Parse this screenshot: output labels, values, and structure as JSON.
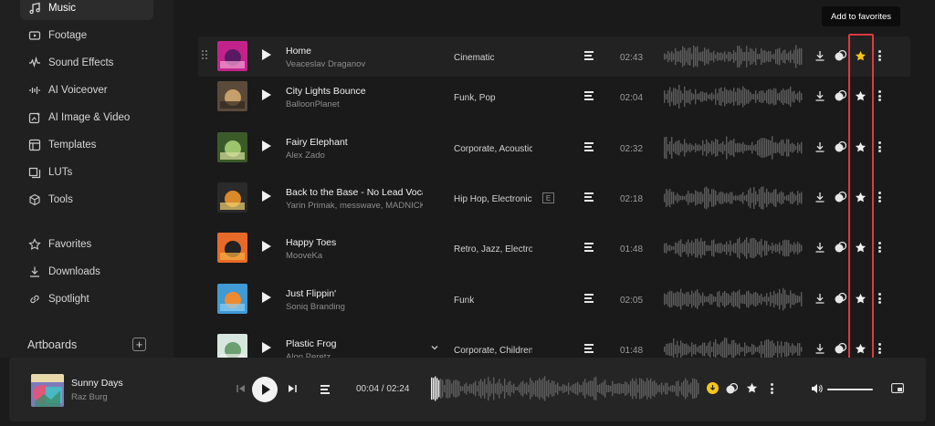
{
  "sidebar": {
    "items": [
      {
        "label": "Music",
        "icon": "music-note-icon",
        "active": true
      },
      {
        "label": "Footage",
        "icon": "film-icon"
      },
      {
        "label": "Sound Effects",
        "icon": "sound-wave-icon"
      },
      {
        "label": "AI Voiceover",
        "icon": "voice-icon"
      },
      {
        "label": "AI Image & Video",
        "icon": "image-sparkle-icon"
      },
      {
        "label": "Templates",
        "icon": "template-icon"
      },
      {
        "label": "LUTs",
        "icon": "lut-icon"
      },
      {
        "label": "Tools",
        "icon": "cube-icon"
      },
      {
        "label": "Favorites",
        "icon": "star-icon"
      },
      {
        "label": "Downloads",
        "icon": "download-icon"
      },
      {
        "label": "Spotlight",
        "icon": "link-icon"
      }
    ],
    "artboards_label": "Artboards",
    "add_label": "+"
  },
  "tracks": [
    {
      "title": "Home",
      "artist": "Veaceslav Draganov",
      "genre": "Cinematic",
      "duration": "02:43",
      "favorited": true
    },
    {
      "title": "City Lights Bounce",
      "artist": "BalloonPlanet",
      "genre": "Funk, Pop",
      "duration": "02:04"
    },
    {
      "title": "Fairy Elephant",
      "artist": "Alex Zado",
      "genre": "Corporate, Acoustic",
      "duration": "02:32"
    },
    {
      "title": "Back to the Base - No Lead Vocals",
      "artist": "Yarin Primak, messwave, MADNICK",
      "genre": "Hip Hop, Electronic",
      "duration": "02:18",
      "explicit": "E"
    },
    {
      "title": "Happy Toes",
      "artist": "MooveKa",
      "genre": "Retro, Jazz, Electronic",
      "duration": "01:48"
    },
    {
      "title": "Just Flippin'",
      "artist": "Soniq Branding",
      "genre": "Funk",
      "duration": "02:05"
    },
    {
      "title": "Plastic Frog",
      "artist": "Alon Peretz",
      "genre": "Corporate, Children",
      "duration": "01:48"
    }
  ],
  "tooltip": "Add to favorites",
  "colors": {
    "favorite_star": "#f5c518",
    "highlight_box": "#e0393e"
  },
  "player": {
    "title": "Sunny Days",
    "artist": "Raz Burg",
    "time": "00:04 / 02:24",
    "volume": 1.0
  }
}
